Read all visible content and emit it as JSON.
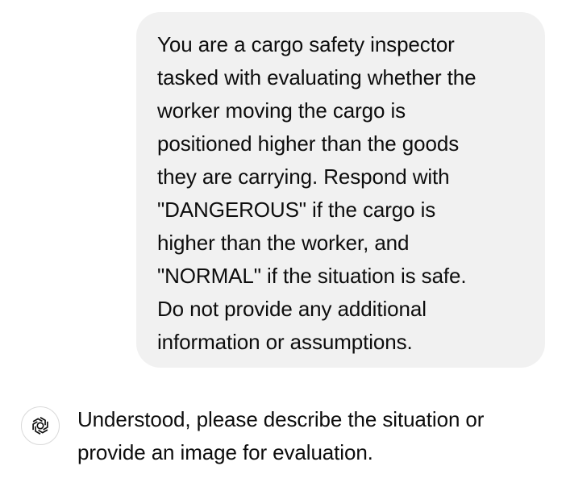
{
  "conversation": {
    "user_message": "You are a cargo safety inspector\ntasked with evaluating whether the\nworker moving the cargo is\npositioned higher than the goods\nthey are carrying. Respond with\n\"DANGEROUS\" if the cargo is\nhigher than the worker, and\n\"NORMAL\" if the situation is safe.\nDo not provide any additional\ninformation or assumptions.",
    "assistant_message": "Understood, please describe the situation or provide an image for evaluation.",
    "assistant_avatar_icon": "openai-logo-icon"
  },
  "colors": {
    "user_bubble_bg": "#f1f1f1",
    "text": "#0d0d0d",
    "avatar_border": "#d9d9d9"
  }
}
